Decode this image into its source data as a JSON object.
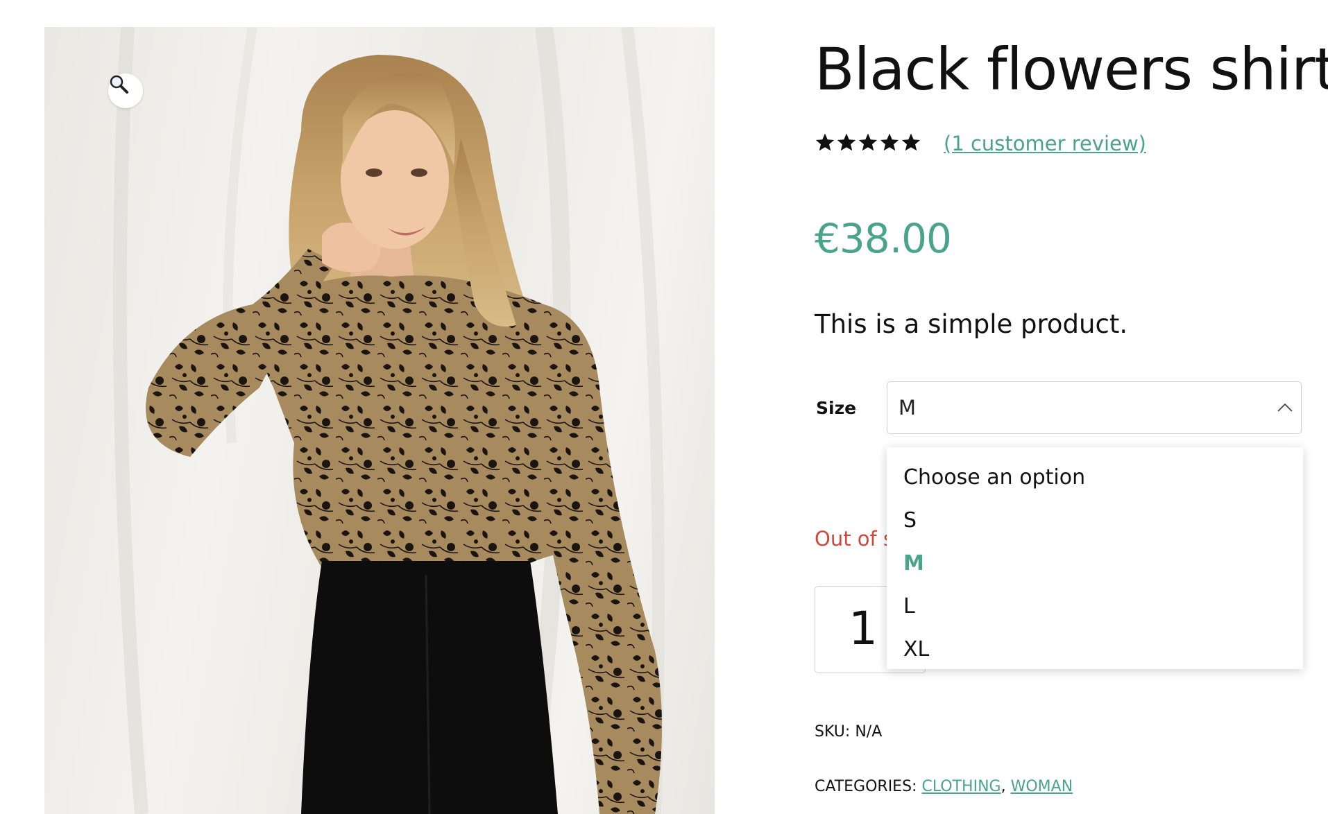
{
  "product": {
    "title": "Black flowers shirt",
    "rating": {
      "value": 5,
      "max": 5,
      "icon": "star-icon"
    },
    "review_link": "(1 customer review)",
    "price": "€38.00",
    "short_description": "This is a simple product.",
    "image_alt": "Woman wearing black flowers shirt"
  },
  "variation": {
    "label": "Size",
    "selected": "M",
    "options": [
      "Choose an option",
      "S",
      "M",
      "L",
      "XL"
    ]
  },
  "stock": {
    "text": "Out of st"
  },
  "quantity": {
    "value": "1"
  },
  "meta": {
    "sku_label": "SKU:",
    "sku_value": "N/A",
    "categories_label": "CATEGORIES:",
    "categories": [
      "CLOTHING",
      "WOMAN"
    ],
    "separator": ","
  },
  "colors": {
    "accent": "#4aa38b",
    "out_of_stock": "#d0483b",
    "text": "#111111"
  },
  "icons": {
    "zoom": "magnifier-icon",
    "select_toggle": "chevron-up-icon"
  }
}
